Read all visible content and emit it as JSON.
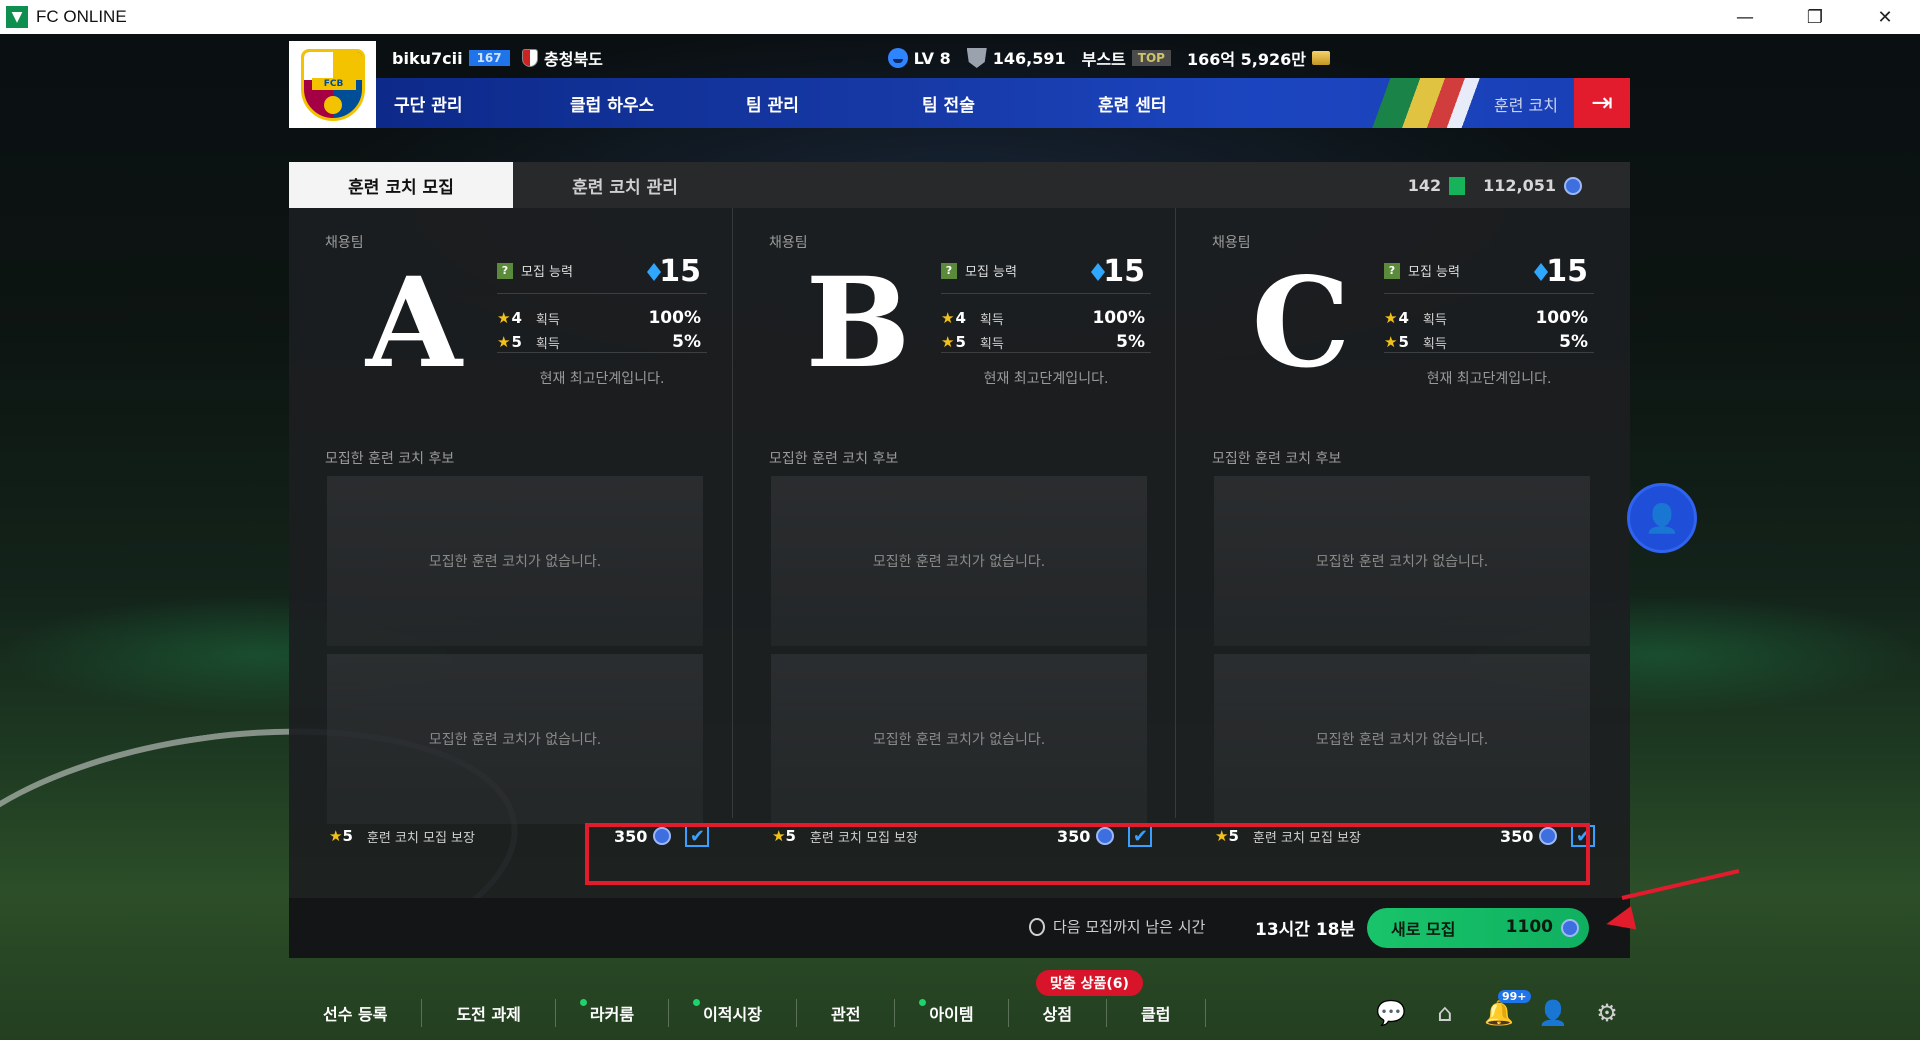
{
  "window": {
    "title": "FC ONLINE",
    "logo_glyph": "▼",
    "controls": [
      "—",
      "❐",
      "✕"
    ]
  },
  "profile": {
    "username": "biku7cii",
    "level_badge": "167",
    "region": "충청북도",
    "stats": {
      "lv": "LV 8",
      "fans": "146,591",
      "boost_label": "부스트",
      "boost_rank": "TOP",
      "money": "166억 5,926만"
    },
    "crest_text": "FCB"
  },
  "nav": {
    "items": [
      "구단 관리",
      "클럽 하우스",
      "팀 관리",
      "팀 전술",
      "훈련 센터"
    ],
    "current": "훈련 코치",
    "exit_glyph": "⇥"
  },
  "tabs": {
    "active": "훈련 코치 모집",
    "inactive": "훈련 코치 관리"
  },
  "currency": {
    "tickets": "142",
    "fc": "112,051"
  },
  "columns": [
    {
      "label": "채용팀",
      "grade": "A",
      "ability_label": "모집 능력",
      "ability_value": "15",
      "rates": [
        {
          "stars": "4",
          "get": "획득",
          "pct": "100%"
        },
        {
          "stars": "5",
          "get": "획득",
          "pct": "5%"
        }
      ],
      "max_note": "현재 최고단계입니다.",
      "candidates_label": "모집한 훈련 코치 후보",
      "empty_slots": [
        "모집한 훈련 코치가 없습니다.",
        "모집한 훈련 코치가 없습니다."
      ],
      "guarantee": {
        "stars": "5",
        "label": "훈련 코치 모집 보장",
        "price": "350"
      }
    },
    {
      "label": "채용팀",
      "grade": "B",
      "ability_label": "모집 능력",
      "ability_value": "15",
      "rates": [
        {
          "stars": "4",
          "get": "획득",
          "pct": "100%"
        },
        {
          "stars": "5",
          "get": "획득",
          "pct": "5%"
        }
      ],
      "max_note": "현재 최고단계입니다.",
      "candidates_label": "모집한 훈련 코치 후보",
      "empty_slots": [
        "모집한 훈련 코치가 없습니다.",
        "모집한 훈련 코치가 없습니다."
      ],
      "guarantee": {
        "stars": "5",
        "label": "훈련 코치 모집 보장",
        "price": "350"
      }
    },
    {
      "label": "채용팀",
      "grade": "C",
      "ability_label": "모집 능력",
      "ability_value": "15",
      "rates": [
        {
          "stars": "4",
          "get": "획득",
          "pct": "100%"
        },
        {
          "stars": "5",
          "get": "획득",
          "pct": "5%"
        }
      ],
      "max_note": "현재 최고단계입니다.",
      "candidates_label": "모집한 훈련 코치 후보",
      "empty_slots": [
        "모집한 훈련 코치가 없습니다.",
        "모집한 훈련 코치가 없습니다."
      ],
      "guarantee": {
        "stars": "5",
        "label": "훈련 코치 모집 보장",
        "price": "350"
      }
    }
  ],
  "footer": {
    "timer_label": "다음 모집까지 남은 시간",
    "timer_value": "13시간 18분",
    "recruit_label": "새로 모집",
    "recruit_cost": "1100"
  },
  "bottom_nav": {
    "items": [
      "선수 등록",
      "도전 과제",
      "라커룸",
      "이적시장",
      "관전",
      "아이템",
      "상점",
      "클럽"
    ],
    "promo": "맞춤 상품(6)",
    "notification_count": "99+"
  },
  "glyphs": {
    "star": "★",
    "check": "✔",
    "question": "?"
  },
  "colors": {
    "nav_blue": "#173aa8",
    "exit_red": "#e21b2d",
    "recruit_green": "#18c46a",
    "star_gold": "#f2c21b",
    "diamond_blue": "#2fa7ff"
  }
}
